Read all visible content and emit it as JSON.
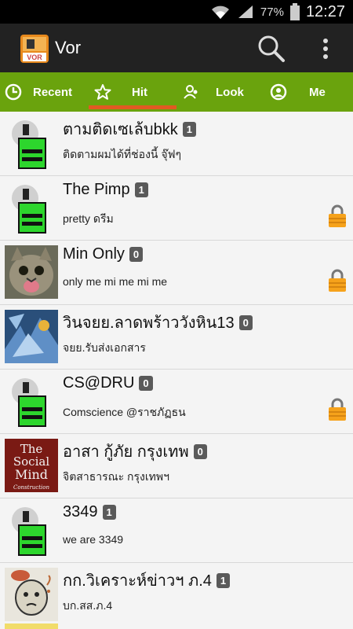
{
  "status_bar": {
    "battery_pct": "77%",
    "time": "12:27",
    "icons": [
      "wifi-icon",
      "signal-icon",
      "battery-icon"
    ]
  },
  "app": {
    "title": "Vor",
    "logo_text": "VOR"
  },
  "tabs": [
    {
      "label": "Recent",
      "icon": "clock-icon"
    },
    {
      "label": "Hit",
      "icon": "star-icon",
      "selected": true
    },
    {
      "label": "Look",
      "icon": "users-icon"
    },
    {
      "label": "Me",
      "icon": "person-icon"
    }
  ],
  "colors": {
    "accent": "#6aa30d",
    "indicator": "#e05a22",
    "appbar": "#222222"
  },
  "items": [
    {
      "name": "ตามติดเซเล้บbkk",
      "count": "1",
      "status": "ติดตามผมได้ที่ช่องนี้ จุ๊ฟๆ",
      "locked": false,
      "avatar": "default"
    },
    {
      "name": "The Pimp",
      "count": "1",
      "status": "pretty ดรีม",
      "locked": true,
      "avatar": "default"
    },
    {
      "name": "Min Only",
      "count": "0",
      "status": "only me mi me mi me",
      "locked": true,
      "avatar": "cat"
    },
    {
      "name": "วินจยย.ลาดพร้าววังหิน13",
      "count": "0",
      "status": "จยย.รับส่งเอกสาร",
      "locked": false,
      "avatar": "blue-art"
    },
    {
      "name": "CS@DRU",
      "count": "0",
      "status": "Comscience @ราชภัฏธน",
      "locked": true,
      "avatar": "default"
    },
    {
      "name": "อาสา กู้ภัย กรุงเทพ",
      "count": "0",
      "status": "จิตสาธารณะ กรุงเทพฯ",
      "locked": false,
      "avatar": "social-mind"
    },
    {
      "name": "3349",
      "count": "1",
      "status": "we are 3349",
      "locked": false,
      "avatar": "default"
    },
    {
      "name": "กก.วิเคราะห์ข่าวฯ ภ.4",
      "count": "1",
      "status": "บก.สส.ภ.4",
      "locked": false,
      "avatar": "cartoon"
    }
  ],
  "avatar_text": {
    "social_mind_1": "The",
    "social_mind_2": "Social",
    "social_mind_3": "Mind",
    "social_mind_4": "Construction"
  }
}
